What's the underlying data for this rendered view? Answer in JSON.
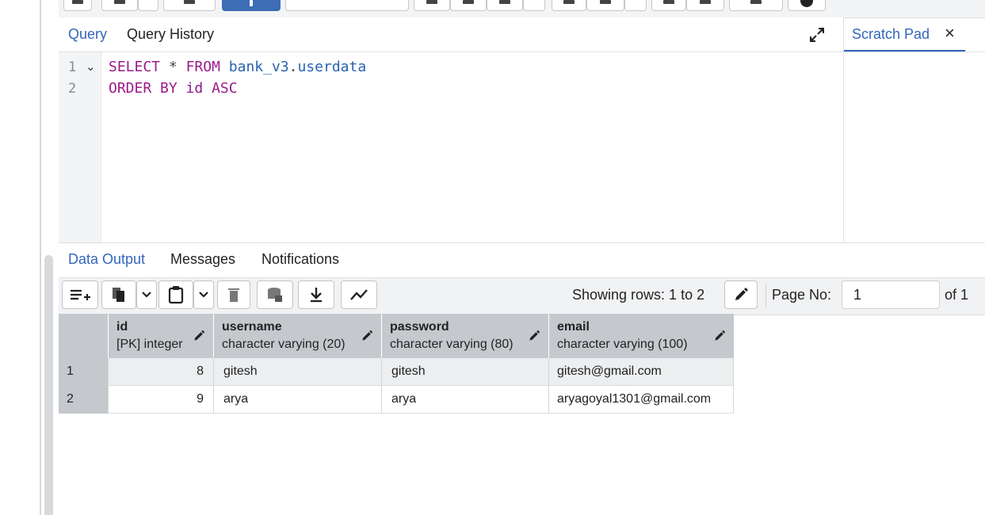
{
  "editor_tabs": {
    "query": "Query",
    "history": "Query History"
  },
  "scratch_pad": {
    "title": "Scratch Pad",
    "close": "×"
  },
  "editor": {
    "lines": [
      {
        "no": "1",
        "fold": "⌄"
      },
      {
        "no": "2"
      }
    ],
    "line1": {
      "kw1": "SELECT",
      "op": "*",
      "kw2": "FROM",
      "schema": "bank_v3",
      "dot": ".",
      "table": "userdata"
    },
    "line2": {
      "kw": "ORDER BY",
      "col": "id",
      "dir": "ASC"
    }
  },
  "output_tabs": {
    "data": "Data Output",
    "messages": "Messages",
    "notifications": "Notifications"
  },
  "output_toolbar": {
    "status": "Showing rows: 1 to 2",
    "page_label": "Page No:",
    "page_value": "1",
    "page_of": "of 1"
  },
  "grid": {
    "columns": [
      {
        "name": "id",
        "type": "[PK] integer"
      },
      {
        "name": "username",
        "type": "character varying (20)"
      },
      {
        "name": "password",
        "type": "character varying (80)"
      },
      {
        "name": "email",
        "type": "character varying (100)"
      }
    ],
    "rows": [
      {
        "n": "1",
        "id": "8",
        "username": "gitesh",
        "password": "gitesh",
        "email": "gitesh@gmail.com"
      },
      {
        "n": "2",
        "id": "9",
        "username": "arya",
        "password": "arya",
        "email": "aryagoyal1301@gmail.com"
      }
    ]
  },
  "colors": {
    "accent": "#3366bb",
    "keyword": "#9b1b8a",
    "identifier": "#2a63b0",
    "header_bg": "#c5c8cd"
  }
}
